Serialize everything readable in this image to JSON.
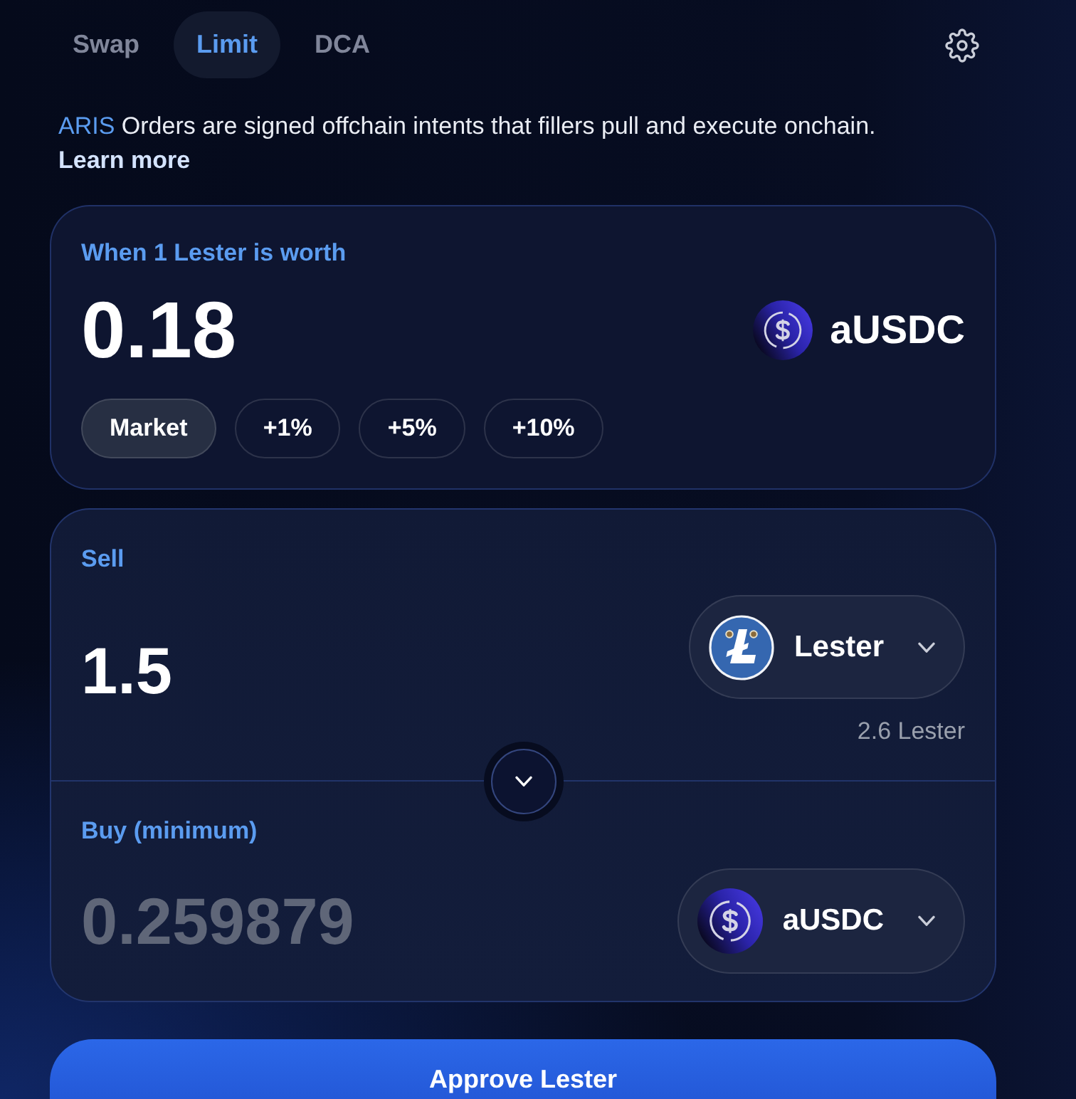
{
  "tabs": [
    {
      "label": "Swap",
      "selected": false
    },
    {
      "label": "Limit",
      "selected": true
    },
    {
      "label": "DCA",
      "selected": false
    }
  ],
  "notice": {
    "brand": "ARIS",
    "text": "Orders are signed offchain intents that fillers pull and execute onchain.",
    "link": "Learn more"
  },
  "price": {
    "label": "When 1 Lester is worth",
    "value": "0.18",
    "token": {
      "symbol": "aUSDC",
      "kind": "dollar-coin"
    },
    "presets": [
      {
        "label": "Market",
        "selected": true
      },
      {
        "label": "+1%",
        "selected": false
      },
      {
        "label": "+5%",
        "selected": false
      },
      {
        "label": "+10%",
        "selected": false
      }
    ]
  },
  "panels": [
    {
      "label": "Sell",
      "amount": "1.5",
      "estimated": false,
      "token": {
        "symbol": "Lester",
        "kind": "letter-coin"
      },
      "balance": "2.6 Lester"
    },
    {
      "label": "Buy (minimum)",
      "amount": "0.259879",
      "estimated": true,
      "token": {
        "symbol": "aUSDC",
        "kind": "dollar-coin"
      }
    }
  ],
  "primary_button": "Approve Lester"
}
